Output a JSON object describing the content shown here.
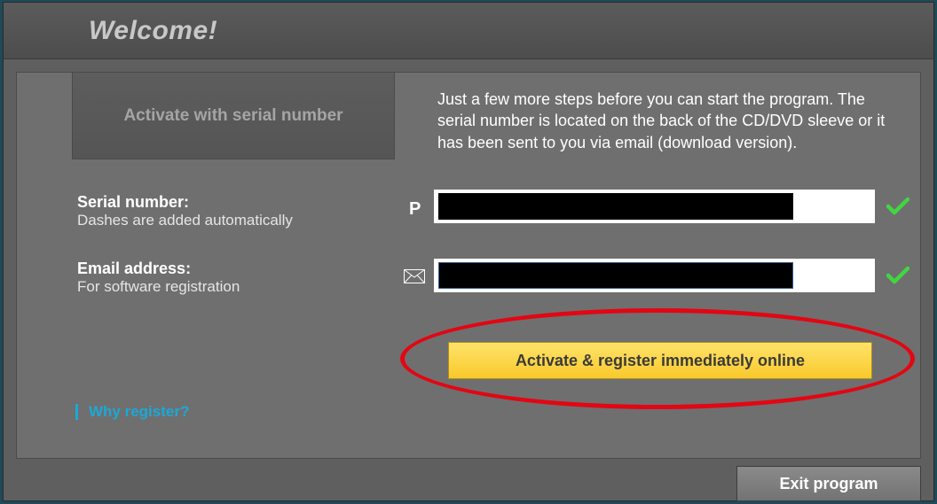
{
  "header": {
    "title": "Welcome!"
  },
  "tab": {
    "label": "Activate with serial number"
  },
  "info_text": "Just a few more steps before you can start the program. The serial number is located on the back of the CD/DVD sleeve or it has been sent to you via email (download version).",
  "serial": {
    "label": "Serial number:",
    "sub": "Dashes are added automatically",
    "prefix": "P",
    "value": "",
    "valid": true
  },
  "email": {
    "label": "Email address:",
    "sub": "For software registration",
    "value": "",
    "valid": true
  },
  "activate_button": "Activate & register immediately online",
  "why_link": "Why register?",
  "exit_button": "Exit program",
  "colors": {
    "accent_yellow": "#f9c92b",
    "accent_cyan": "#1aa9d8",
    "highlight_red": "#e30613",
    "valid_green": "#41d641"
  }
}
